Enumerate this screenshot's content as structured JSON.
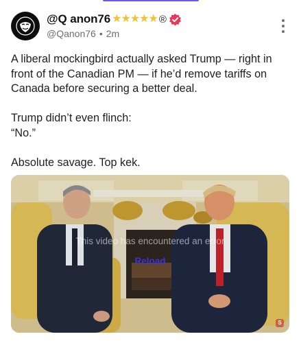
{
  "post": {
    "display_name": "@Q anon76",
    "rating_stars": "★★★★★",
    "registered_mark": "®",
    "handle": "@Qanon76",
    "separator": "•",
    "timestamp": "2m",
    "text_lines": {
      "l1": "A liberal mockingbird actually asked Trump — right in",
      "l2": "front of the Canadian PM — if he’d remove tariffs on",
      "l3": "Canada before securing a better deal.",
      "l4": "Trump didn’t even flinch:",
      "l5": "“No.”",
      "l6": "Absolute savage. Top kek."
    }
  },
  "video": {
    "error_message": "This video has encountered an error",
    "reload_label": "Reload",
    "badge": "S"
  },
  "icons": {
    "avatar": "anonymous-mask-icon",
    "verified": "verified-badge-icon",
    "more": "more-vertical-icon"
  },
  "colors": {
    "accent": "#6b57e8",
    "verified": "#e8365d",
    "stars": "#f2c230",
    "reload": "#3f33cf"
  }
}
